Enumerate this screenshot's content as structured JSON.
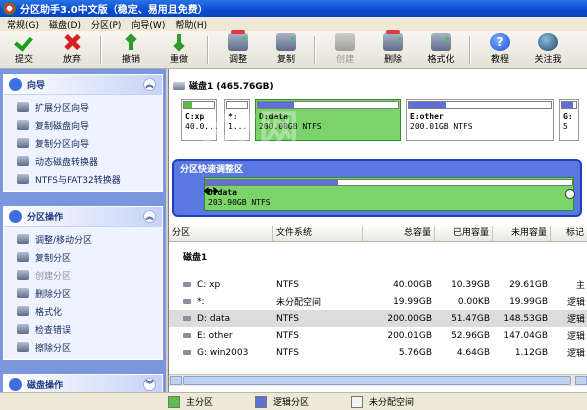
{
  "window": {
    "title": "分区助手3.0中文版（稳定、易用且免费）"
  },
  "menu": [
    "常规(G)",
    "磁盘(D)",
    "分区(P)",
    "向导(W)",
    "帮助(H)"
  ],
  "toolbar": {
    "submit": "提交",
    "discard": "放弃",
    "undo": "撤销",
    "redo": "重做",
    "resize": "调整",
    "copy": "复制",
    "create": "创建",
    "delete": "删除",
    "format": "格式化",
    "tutorial": "教程",
    "about": "关注我"
  },
  "sidebar": {
    "wizard": {
      "title": "向导",
      "items": [
        "扩展分区向导",
        "复制磁盘向导",
        "复制分区向导",
        "动态磁盘转换器",
        "NTFS与FAT32转换器"
      ]
    },
    "partition_ops": {
      "title": "分区操作",
      "items": [
        "调整/移动分区",
        "复制分区",
        "创建分区",
        "删除分区",
        "格式化",
        "检查错误",
        "擦除分区"
      ]
    },
    "disk_ops": {
      "title": "磁盘操作"
    }
  },
  "disk": {
    "header": "磁盘1 (465.76GB)",
    "blocks": [
      {
        "name": "C:xp",
        "size": "40.0...",
        "fill": 0.26,
        "color": "#5bbf4a"
      },
      {
        "name": "*:",
        "size": "1...",
        "fill": 0.0,
        "color": "#888888"
      },
      {
        "name": "D:data",
        "size": "200.00GB NTFS",
        "fill": 0.26,
        "color": "#5e6fd6"
      },
      {
        "name": "E:other",
        "size": "200.01GB NTFS",
        "fill": 0.26,
        "color": "#5e6fd6"
      },
      {
        "name": "G:",
        "size": "5",
        "fill": 0.8,
        "color": "#5e6fd6"
      }
    ]
  },
  "quick": {
    "label": "分区快速调整区",
    "name": "D:data",
    "size": "203.90GB NTFS",
    "fill": 0.36
  },
  "table": {
    "headers": [
      "分区",
      "文件系统",
      "总容量",
      "已用容量",
      "未用容量",
      "标记"
    ],
    "group": "磁盘1",
    "rows": [
      {
        "part": "C:  xp",
        "fs": "NTFS",
        "total": "40.00GB",
        "used": "10.39GB",
        "free": "29.61GB",
        "flag": "主"
      },
      {
        "part": "*:",
        "fs": "未分配空间",
        "total": "19.99GB",
        "used": "0.00KB",
        "free": "19.99GB",
        "flag": "逻辑"
      },
      {
        "part": "D:  data",
        "fs": "NTFS",
        "total": "200.00GB",
        "used": "51.47GB",
        "free": "148.53GB",
        "flag": "逻辑",
        "selected": true
      },
      {
        "part": "E:  other",
        "fs": "NTFS",
        "total": "200.01GB",
        "used": "52.96GB",
        "free": "147.04GB",
        "flag": "逻辑"
      },
      {
        "part": "G:  win2003",
        "fs": "NTFS",
        "total": "5.76GB",
        "used": "4.64GB",
        "free": "1.12GB",
        "flag": "逻辑"
      }
    ]
  },
  "legend": {
    "primary": "主分区",
    "logical": "逻辑分区",
    "unallocated": "未分配空间"
  },
  "colors": {
    "primary": "#5bbf4a",
    "logical": "#5e6fd6",
    "unallocated": "#f4f4f4",
    "title_bar": "#0a4bd0",
    "sidebar": "#7a96df"
  }
}
